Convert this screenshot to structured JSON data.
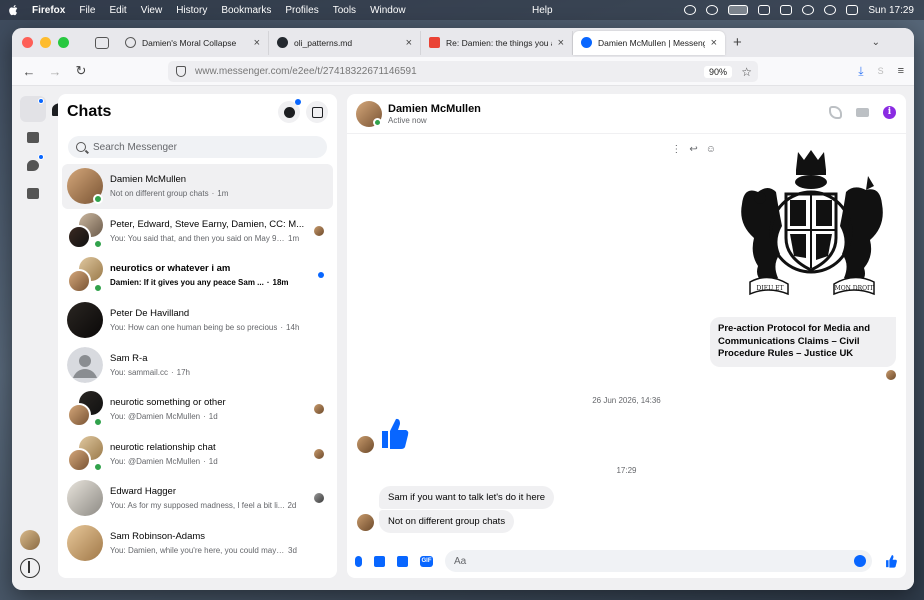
{
  "menubar": {
    "app": "Firefox",
    "items": [
      "File",
      "Edit",
      "View",
      "History",
      "Bookmarks",
      "Profiles",
      "Tools",
      "Window"
    ],
    "help": "Help",
    "clock": "Sun 17:29"
  },
  "tabs": [
    {
      "title": "Damien's Moral Collapse",
      "favicon_color": "#5a5a5a",
      "active": false
    },
    {
      "title": "oli_patterns.md",
      "favicon_color": "#24292f",
      "active": false
    },
    {
      "title": "Re: Damien: the things you are s",
      "favicon_color": "#ea4335",
      "active": false
    },
    {
      "title": "Damien McMullen | Messenger",
      "favicon_color": "#0866ff",
      "active": true
    }
  ],
  "address": {
    "host": "www.messenger.com",
    "path": "/e2ee/t/27418322671146591",
    "zoom": "90%"
  },
  "sidebar": {
    "title": "Chats",
    "search_placeholder": "Search Messenger"
  },
  "chats": [
    {
      "name": "Damien McMullen",
      "preview": "Not on different group chats",
      "time": "1m",
      "selected": true,
      "group": false,
      "online": true,
      "unread": false,
      "seen": false
    },
    {
      "name": "Peter, Edward, Steve Earny, Damien, CC: M...",
      "preview": "You: You said that, and then you said on May 9t...",
      "time": "1m",
      "selected": false,
      "group": true,
      "online": true,
      "unread": false,
      "seen": true
    },
    {
      "name": "neurotics or whatever i am",
      "preview": "Damien: If it gives you any peace Sam ...",
      "time": "18m",
      "selected": false,
      "group": true,
      "online": true,
      "unread": true,
      "seen": false
    },
    {
      "name": "Peter De Havilland",
      "preview": "You: How can one human being be so precious",
      "time": "14h",
      "selected": false,
      "group": false,
      "online": false,
      "unread": false,
      "seen": false
    },
    {
      "name": "Sam R-a",
      "preview": "You: sammail.cc",
      "time": "17h",
      "selected": false,
      "group": false,
      "online": false,
      "unread": false,
      "seen": false
    },
    {
      "name": "neurotic something or other",
      "preview": "You: @Damien McMullen",
      "time": "1d",
      "selected": false,
      "group": true,
      "online": true,
      "unread": false,
      "seen": true
    },
    {
      "name": "neurotic relationship chat",
      "preview": "You: @Damien McMullen",
      "time": "1d",
      "selected": false,
      "group": true,
      "online": true,
      "unread": false,
      "seen": true
    },
    {
      "name": "Edward Hagger",
      "preview": "You: As for my supposed madness, I feel a bit li...",
      "time": "2d",
      "selected": false,
      "group": false,
      "online": false,
      "unread": false,
      "seen": true
    },
    {
      "name": "Sam Robinson-Adams",
      "preview": "You: Damien, while you're here, you could maybe: ...",
      "time": "3d",
      "selected": false,
      "group": false,
      "online": false,
      "unread": false,
      "seen": false
    }
  ],
  "conversation": {
    "name": "Damien McMullen",
    "status": "Active now",
    "link_card": "Pre-action Protocol for Media and Communications Claims – Civil Procedure Rules – Justice UK",
    "crest_motto_left": "DIEU ET",
    "crest_motto_right": "MON DROIT",
    "timestamp_1": "26 Jun 2026, 14:36",
    "timestamp_2": "17:29",
    "messages": [
      {
        "text": "Sam if you want to talk let's do it here"
      },
      {
        "text": "Not on different group chats"
      }
    ],
    "composer_placeholder": "Aa",
    "info_icon": "i",
    "gif_label": "GIF"
  },
  "colors": {
    "accent": "#0866ff",
    "online": "#31a24c",
    "info": "#8a2be2"
  },
  "icons": {
    "back": "←",
    "forward": "→",
    "reload": "↻",
    "star": "☆",
    "download": "⤓",
    "menu": "≡",
    "plus": "+",
    "chevron": "⌄",
    "close": "×",
    "more": "⋮",
    "reply": "↩",
    "react": "☺"
  }
}
